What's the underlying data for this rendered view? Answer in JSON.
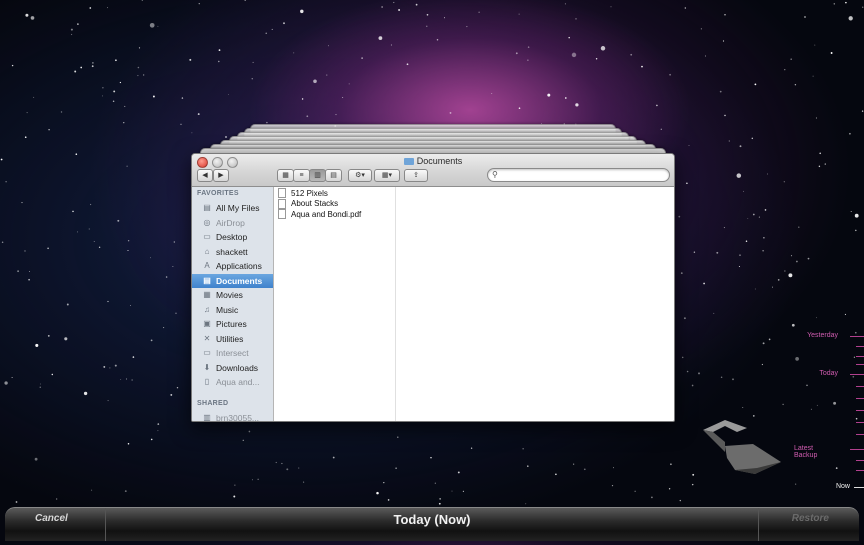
{
  "window": {
    "title": "Documents",
    "stack_title": "Documents"
  },
  "sidebar": {
    "favorites_header": "FAVORITES",
    "items": [
      {
        "label": "All My Files",
        "icon": "all-files-icon"
      },
      {
        "label": "AirDrop",
        "icon": "airdrop-icon",
        "dim": true
      },
      {
        "label": "Desktop",
        "icon": "desktop-icon"
      },
      {
        "label": "shackett",
        "icon": "home-icon"
      },
      {
        "label": "Applications",
        "icon": "applications-icon"
      },
      {
        "label": "Documents",
        "icon": "documents-icon",
        "selected": true
      },
      {
        "label": "Movies",
        "icon": "movies-icon"
      },
      {
        "label": "Music",
        "icon": "music-icon"
      },
      {
        "label": "Pictures",
        "icon": "pictures-icon"
      },
      {
        "label": "Utilities",
        "icon": "utilities-icon"
      },
      {
        "label": "Intersect",
        "icon": "folder-icon",
        "dim": true
      },
      {
        "label": "Downloads",
        "icon": "downloads-icon"
      },
      {
        "label": "Aqua and...",
        "icon": "document-icon",
        "dim": true
      }
    ],
    "shared_header": "SHARED",
    "shared_items": [
      {
        "label": "brn30055...",
        "icon": "printer-icon",
        "dim": true
      }
    ]
  },
  "files": [
    {
      "name": "512 Pixels"
    },
    {
      "name": "About Stacks"
    },
    {
      "name": "Aqua and Bondi.pdf"
    }
  ],
  "timeline": {
    "yesterday": "Yesterday",
    "today": "Today",
    "latest_backup": "Latest Backup",
    "now": "Now"
  },
  "bottombar": {
    "cancel": "Cancel",
    "title": "Today (Now)",
    "restore": "Restore"
  },
  "colors": {
    "accent": "#3f82cc",
    "timeline": "#d05cb0"
  }
}
